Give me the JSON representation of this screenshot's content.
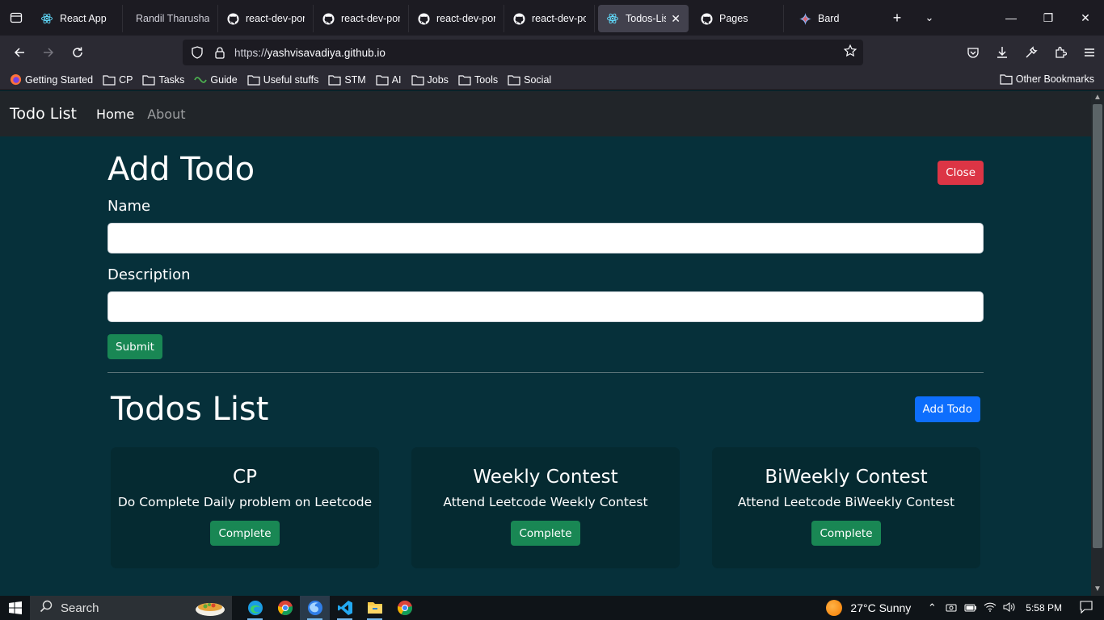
{
  "browser": {
    "tabs": [
      {
        "label": "React App",
        "icon": "react-icon",
        "active": false
      },
      {
        "label": "Randil Tharusha | A",
        "icon": "none",
        "active": false
      },
      {
        "label": "react-dev-por",
        "icon": "github-icon",
        "active": false
      },
      {
        "label": "react-dev-por",
        "icon": "github-icon",
        "active": false
      },
      {
        "label": "react-dev-por",
        "icon": "github-icon",
        "active": false
      },
      {
        "label": "react-dev-por",
        "icon": "github-icon",
        "active": false
      },
      {
        "label": "Todos-List |",
        "icon": "react-icon",
        "active": true
      },
      {
        "label": "Pages",
        "icon": "github-icon",
        "active": false
      },
      {
        "label": "Bard",
        "icon": "bard-icon",
        "active": false
      }
    ],
    "url_prefix": "https://",
    "url_host": "yashvisavadiya.github.io",
    "bookmarks": [
      {
        "label": "Getting Started",
        "icon": "firefox-icon"
      },
      {
        "label": "CP",
        "icon": "folder-icon"
      },
      {
        "label": "Tasks",
        "icon": "folder-icon"
      },
      {
        "label": "Guide",
        "icon": "guide-icon"
      },
      {
        "label": "Useful stuffs",
        "icon": "folder-icon"
      },
      {
        "label": "STM",
        "icon": "folder-icon"
      },
      {
        "label": "AI",
        "icon": "folder-icon"
      },
      {
        "label": "Jobs",
        "icon": "folder-icon"
      },
      {
        "label": "Tools",
        "icon": "folder-icon"
      },
      {
        "label": "Social",
        "icon": "folder-icon"
      }
    ],
    "other_bookmarks": "Other Bookmarks"
  },
  "app": {
    "brand": "Todo List",
    "nav": {
      "home": "Home",
      "about": "About"
    },
    "add_form": {
      "title": "Add Todo",
      "close_label": "Close",
      "name_label": "Name",
      "name_value": "",
      "description_label": "Description",
      "description_value": "",
      "submit_label": "Submit"
    },
    "list": {
      "title": "Todos List",
      "add_label": "Add Todo",
      "todos": [
        {
          "title": "CP",
          "desc": "Do Complete Daily problem on Leetcode",
          "action": "Complete"
        },
        {
          "title": "Weekly Contest",
          "desc": "Attend Leetcode Weekly Contest",
          "action": "Complete"
        },
        {
          "title": "BiWeekly Contest",
          "desc": "Attend Leetcode BiWeekly Contest",
          "action": "Complete"
        }
      ]
    }
  },
  "taskbar": {
    "search_label": "Search",
    "weather": "27°C  Sunny",
    "time": "5:58 PM"
  },
  "colors": {
    "page_bg": "#06303a",
    "navbar_bg": "#212529",
    "card_bg": "#052a31",
    "danger": "#dc3545",
    "success": "#198754",
    "primary": "#0d6efd"
  }
}
